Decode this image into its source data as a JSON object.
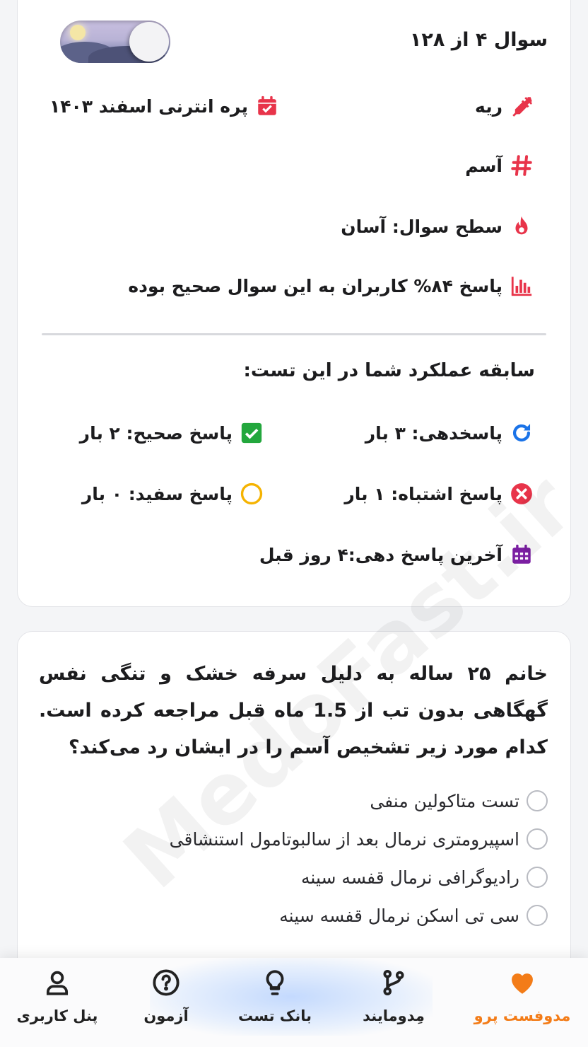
{
  "header": {
    "question_position": "سوال ۴ از ۱۲۸"
  },
  "meta": {
    "subject": "ریه",
    "exam": "پره انترنی اسفند ۱۴۰۳",
    "topic": "آسم",
    "difficulty": "سطح سوال: آسان",
    "correct_rate": "پاسخ ۸۴% کاربران به این سوال صحیح بوده"
  },
  "performance": {
    "title": "سابقه عملکرد شما در این تست:",
    "attempts": "پاسخدهی: ۳ بار",
    "correct": "پاسخ صحیح: ۲ بار",
    "wrong": "پاسخ اشتباه: ۱ بار",
    "blank": "پاسخ سفید: ۰ بار",
    "last_answer": "آخرین پاسخ دهی:۴ روز قبل"
  },
  "question": {
    "text": "خانم ۲۵ ساله به دلیل سرفه خشک و تنگی نفس گهگاهی بدون تب از 1.5 ماه قبل مراجعه کرده است. کدام مورد زیر تشخیص آسم را در ایشان رد می‌کند؟",
    "options": [
      "تست متاکولین منفی",
      "اسپیرومتری نرمال بعد از سالبوتامول استنشاقی",
      "رادیوگرافی نرمال قفسه سینه",
      "سی تی اسکن نرمال قفسه سینه"
    ]
  },
  "watermark": "MedoFast.ir",
  "nav": {
    "items": [
      {
        "label": "مدوفست پرو",
        "icon": "heart-icon"
      },
      {
        "label": "مِدومایند",
        "icon": "git-branch-icon"
      },
      {
        "label": "بانک تست",
        "icon": "lightbulb-icon"
      },
      {
        "label": "آزمون",
        "icon": "question-circle-icon"
      },
      {
        "label": "پنل کاربری",
        "icon": "user-icon"
      }
    ],
    "active_index": 0
  },
  "colors": {
    "accent_red": "#e8344a",
    "blue": "#1a73e8",
    "green": "#23a73d",
    "yellow": "#f5b301",
    "purple": "#7b1fa2",
    "nav_active": "#f37c18"
  }
}
